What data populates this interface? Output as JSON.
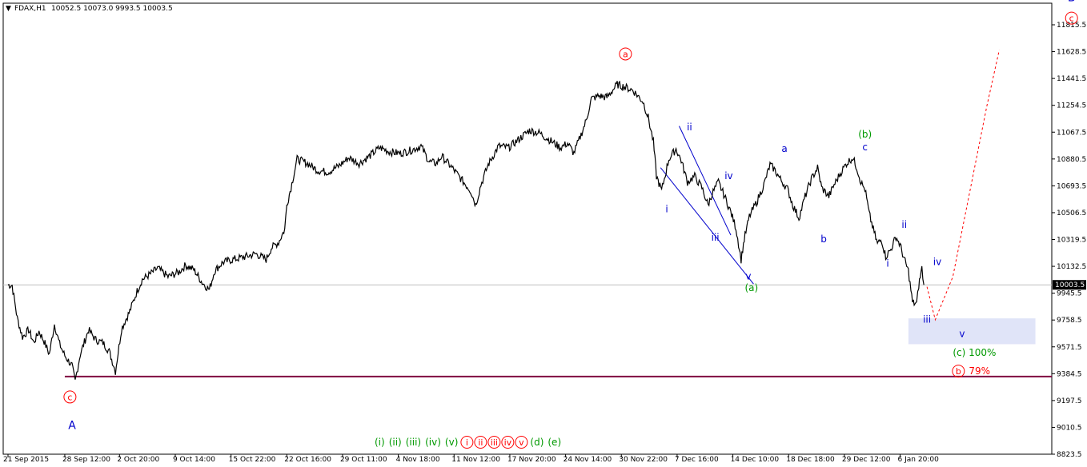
{
  "chart_data": {
    "type": "line",
    "symbol": "FDAX,H1",
    "ohlc": "10052.5 10073.0 9993.5 10003.5",
    "last_price": 10003.5,
    "ylim": [
      8823.5,
      11966.0
    ],
    "yticks": [
      "11815.5",
      "11628.5",
      "11441.5",
      "11254.5",
      "11067.5",
      "10880.5",
      "10693.5",
      "10506.5",
      "10319.5",
      "10132.5",
      "9945.5",
      "9758.5",
      "9571.5",
      "9384.5",
      "9197.5",
      "9010.5",
      "8823.5"
    ],
    "yticks_visible": [
      "11815.5",
      "11628.5",
      "11441.5",
      "11254.5",
      "11067.5",
      "10880.5",
      "10693.5",
      "10506.5",
      "10319.5",
      "10132.5",
      "9945.5",
      "9758.5",
      "9571.5",
      "9384.5",
      "9197.5",
      "9010.5",
      "8823.5"
    ],
    "xticks": [
      "21 Sep 2015",
      "28 Sep 12:00",
      "2 Oct 20:00",
      "9 Oct 14:00",
      "15 Oct 22:00",
      "22 Oct 16:00",
      "29 Oct 11:00",
      "4 Nov 18:00",
      "11 Nov 12:00",
      "17 Nov 20:00",
      "24 Nov 14:00",
      "30 Nov 22:00",
      "7 Dec 16:00",
      "14 Dec 10:00",
      "18 Dec 18:00",
      "29 Dec 12:00",
      "6 Jan 20:00"
    ],
    "x_index_max": 1000,
    "xtick_index": [
      0,
      55,
      108,
      162,
      216,
      270,
      324,
      378,
      432,
      486,
      540,
      594,
      648,
      702,
      756,
      810,
      864
    ],
    "series": [
      {
        "values": [
          [
            0,
            10003
          ],
          [
            4,
            10000
          ],
          [
            9,
            9770
          ],
          [
            14,
            9640
          ],
          [
            20,
            9690
          ],
          [
            25,
            9600
          ],
          [
            30,
            9680
          ],
          [
            35,
            9610
          ],
          [
            40,
            9520
          ],
          [
            45,
            9730
          ],
          [
            50,
            9590
          ],
          [
            55,
            9510
          ],
          [
            62,
            9440
          ],
          [
            65,
            9330
          ],
          [
            70,
            9520
          ],
          [
            78,
            9690
          ],
          [
            85,
            9620
          ],
          [
            92,
            9600
          ],
          [
            98,
            9540
          ],
          [
            102,
            9450
          ],
          [
            104,
            9400
          ],
          [
            110,
            9700
          ],
          [
            118,
            9820
          ],
          [
            125,
            9960
          ],
          [
            130,
            10040
          ],
          [
            138,
            10080
          ],
          [
            145,
            10120
          ],
          [
            155,
            10060
          ],
          [
            165,
            10090
          ],
          [
            172,
            10140
          ],
          [
            180,
            10110
          ],
          [
            188,
            10020
          ],
          [
            195,
            9970
          ],
          [
            200,
            10100
          ],
          [
            208,
            10160
          ],
          [
            218,
            10180
          ],
          [
            230,
            10200
          ],
          [
            240,
            10220
          ],
          [
            250,
            10180
          ],
          [
            255,
            10260
          ],
          [
            262,
            10300
          ],
          [
            268,
            10390
          ],
          [
            270,
            10560
          ],
          [
            274,
            10680
          ],
          [
            280,
            10880
          ],
          [
            290,
            10850
          ],
          [
            300,
            10800
          ],
          [
            310,
            10790
          ],
          [
            320,
            10830
          ],
          [
            330,
            10890
          ],
          [
            340,
            10850
          ],
          [
            350,
            10900
          ],
          [
            360,
            10960
          ],
          [
            370,
            10930
          ],
          [
            380,
            10920
          ],
          [
            390,
            10940
          ],
          [
            400,
            10970
          ],
          [
            408,
            10860
          ],
          [
            415,
            10850
          ],
          [
            420,
            10900
          ],
          [
            430,
            10820
          ],
          [
            440,
            10730
          ],
          [
            448,
            10660
          ],
          [
            453,
            10560
          ],
          [
            458,
            10700
          ],
          [
            465,
            10840
          ],
          [
            475,
            10970
          ],
          [
            485,
            10960
          ],
          [
            495,
            11020
          ],
          [
            505,
            11080
          ],
          [
            515,
            11060
          ],
          [
            525,
            11010
          ],
          [
            535,
            10960
          ],
          [
            542,
            10990
          ],
          [
            548,
            10920
          ],
          [
            555,
            11050
          ],
          [
            560,
            11150
          ],
          [
            565,
            11300
          ],
          [
            572,
            11320
          ],
          [
            580,
            11310
          ],
          [
            590,
            11400
          ],
          [
            598,
            11380
          ],
          [
            605,
            11360
          ],
          [
            615,
            11280
          ],
          [
            620,
            11170
          ],
          [
            625,
            11000
          ],
          [
            628,
            10760
          ],
          [
            633,
            10660
          ],
          [
            640,
            10880
          ],
          [
            647,
            10950
          ],
          [
            652,
            10870
          ],
          [
            658,
            10720
          ],
          [
            665,
            10760
          ],
          [
            672,
            10680
          ],
          [
            678,
            10560
          ],
          [
            682,
            10640
          ],
          [
            688,
            10720
          ],
          [
            694,
            10620
          ],
          [
            700,
            10510
          ],
          [
            705,
            10400
          ],
          [
            710,
            10180
          ],
          [
            713,
            10320
          ],
          [
            718,
            10480
          ],
          [
            725,
            10580
          ],
          [
            732,
            10700
          ],
          [
            738,
            10840
          ],
          [
            742,
            10810
          ],
          [
            748,
            10740
          ],
          [
            755,
            10670
          ],
          [
            760,
            10560
          ],
          [
            766,
            10470
          ],
          [
            772,
            10620
          ],
          [
            778,
            10740
          ],
          [
            784,
            10820
          ],
          [
            788,
            10680
          ],
          [
            795,
            10620
          ],
          [
            800,
            10700
          ],
          [
            806,
            10780
          ],
          [
            812,
            10850
          ],
          [
            818,
            10890
          ],
          [
            822,
            10820
          ],
          [
            826,
            10720
          ],
          [
            828,
            10690
          ],
          [
            830,
            10670
          ],
          [
            834,
            10500
          ],
          [
            838,
            10390
          ],
          [
            842,
            10290
          ],
          [
            846,
            10320
          ],
          [
            850,
            10200
          ],
          [
            855,
            10250
          ],
          [
            860,
            10340
          ],
          [
            864,
            10280
          ],
          [
            868,
            10180
          ],
          [
            872,
            10100
          ],
          [
            876,
            9880
          ],
          [
            880,
            9870
          ],
          [
            882,
            10000
          ],
          [
            885,
            10120
          ],
          [
            887,
            10003
          ]
        ]
      },
      {
        "values": [
          [
            890,
            9990
          ],
          [
            898,
            9760
          ],
          [
            915,
            10060
          ],
          [
            948,
            11250
          ],
          [
            960,
            11640
          ]
        ]
      }
    ],
    "wave_labels": [
      {
        "text": "a",
        "circled": true,
        "x": 598,
        "y": 11590,
        "color": "#ff0000"
      },
      {
        "text": "c",
        "circled": true,
        "x": 1030,
        "y": 11840,
        "color": "#ff0000"
      },
      {
        "text": "B",
        "circled": false,
        "x": 1030,
        "y": 11980,
        "color": "#0000cc"
      },
      {
        "text": "c",
        "circled": true,
        "x": 60,
        "y": 9200,
        "color": "#ff0000"
      },
      {
        "text": "A",
        "circled": false,
        "x": 62,
        "y": 8998,
        "color": "#0000cc"
      },
      {
        "text": "i",
        "x": 638,
        "y": 10510,
        "color": "#0000cc"
      },
      {
        "text": "ii",
        "x": 660,
        "y": 11080,
        "color": "#0000cc"
      },
      {
        "text": "iii",
        "x": 685,
        "y": 10310,
        "color": "#0000cc"
      },
      {
        "text": "iv",
        "x": 698,
        "y": 10740,
        "color": "#0000cc"
      },
      {
        "text": "v",
        "x": 717,
        "y": 10040,
        "color": "#0000cc"
      },
      {
        "text": "(a)",
        "x": 720,
        "y": 9960,
        "color": "#009900"
      },
      {
        "text": "a",
        "x": 752,
        "y": 10930,
        "color": "#0000cc"
      },
      {
        "text": "b",
        "x": 790,
        "y": 10300,
        "color": "#0000cc"
      },
      {
        "text": "c",
        "x": 830,
        "y": 10940,
        "color": "#0000cc"
      },
      {
        "text": "(b)",
        "x": 830,
        "y": 11030,
        "color": "#009900"
      },
      {
        "text": "i",
        "x": 852,
        "y": 10130,
        "color": "#0000cc"
      },
      {
        "text": "ii",
        "x": 868,
        "y": 10400,
        "color": "#0000cc"
      },
      {
        "text": "iii",
        "x": 890,
        "y": 9740,
        "color": "#0000cc"
      },
      {
        "text": "iv",
        "x": 900,
        "y": 10140,
        "color": "#0000cc"
      },
      {
        "text": "v",
        "x": 924,
        "y": 9640,
        "color": "#0000cc"
      }
    ],
    "triangle": [
      [
        632,
        10820
      ],
      [
        650,
        11110
      ],
      [
        700,
        10350
      ],
      [
        722,
        10010
      ]
    ],
    "support_line": 9365,
    "target_box": {
      "x1": 872,
      "x2": 995,
      "y1": 9590,
      "y2": 9770
    },
    "annotations": [
      {
        "text": "(c) 100%",
        "color": "#009900"
      },
      {
        "text": "b",
        "circled": true,
        "color": "#ff0000"
      },
      {
        "text": "79%",
        "color": "#ff0000"
      }
    ],
    "legend_bottom": [
      {
        "text": "(i)",
        "color": "#009900"
      },
      {
        "text": "(ii)",
        "color": "#009900"
      },
      {
        "text": "(iii)",
        "color": "#009900"
      },
      {
        "text": "(iv)",
        "color": "#009900"
      },
      {
        "text": "(v)",
        "color": "#009900"
      },
      {
        "text": "i",
        "circled": true,
        "color": "#ff0000"
      },
      {
        "text": "ii",
        "circled": true,
        "color": "#ff0000"
      },
      {
        "text": "iii",
        "circled": true,
        "color": "#ff0000"
      },
      {
        "text": "iv",
        "circled": true,
        "color": "#ff0000"
      },
      {
        "text": "v",
        "circled": true,
        "color": "#ff0000"
      },
      {
        "text": "(d)",
        "color": "#009900"
      },
      {
        "text": "(e)",
        "color": "#009900"
      }
    ]
  }
}
